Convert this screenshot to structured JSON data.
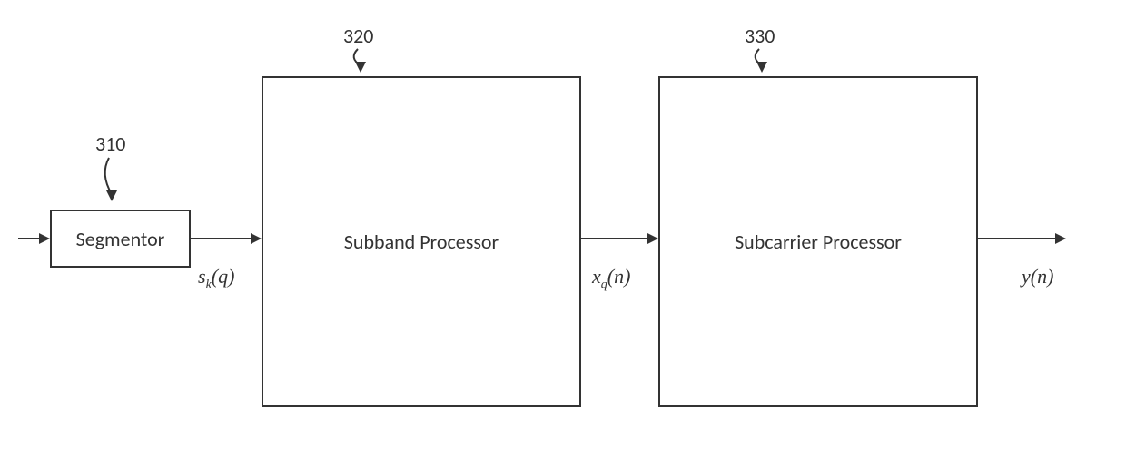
{
  "blocks": {
    "segmentor": {
      "ref": "310",
      "label": "Segmentor"
    },
    "subband": {
      "ref": "320",
      "label": "Subband Processor"
    },
    "subcarrier": {
      "ref": "330",
      "label": "Subcarrier Processor"
    }
  },
  "signals": {
    "s_kq": {
      "prefix": "s",
      "sub": "k",
      "arg": "(q)"
    },
    "x_qn": {
      "prefix": "x",
      "sub": "q",
      "arg": "(n)"
    },
    "y_n": {
      "prefix": "y",
      "sub": "",
      "arg": "(n)"
    }
  }
}
